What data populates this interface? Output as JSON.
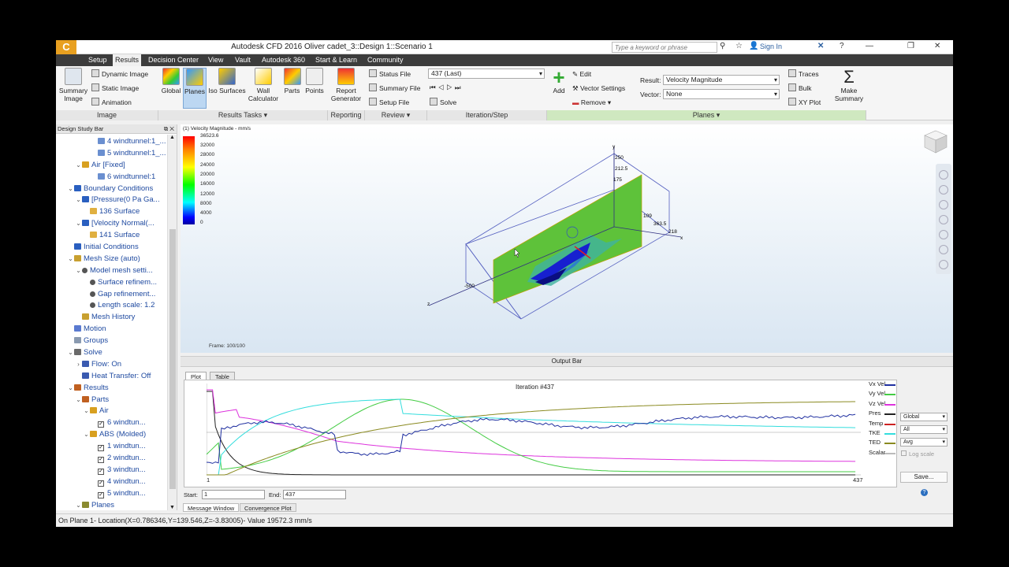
{
  "app": {
    "logo": "C",
    "title": "Autodesk CFD 2016   Oliver cadet_3::Design 1::Scenario 1",
    "search_placeholder": "Type a keyword or phrase",
    "signin": "Sign In"
  },
  "menus": [
    "Setup",
    "Results",
    "Decision Center",
    "View",
    "Vault",
    "Autodesk 360",
    "Start & Learn",
    "Community"
  ],
  "active_menu": "Results",
  "ribbon": {
    "image_group": {
      "summary_image": "Summary Image",
      "dynamic_image": "Dynamic Image",
      "static_image": "Static Image",
      "animation": "Animation",
      "title": "Image"
    },
    "results_tasks": {
      "items": [
        "Global",
        "Planes",
        "Iso Surfaces",
        "Wall Calculator",
        "Parts",
        "Points"
      ],
      "selected": "Planes",
      "title": "Results Tasks ▾"
    },
    "reporting": {
      "report_generator": "Report Generator",
      "title": "Reporting"
    },
    "review": {
      "status_file": "Status File",
      "summary_file": "Summary File",
      "setup_file": "Setup File",
      "title": "Review ▾"
    },
    "iteration": {
      "current": "437 (Last)",
      "solve": "Solve",
      "title": "Iteration/Step"
    },
    "planes": {
      "add": "Add",
      "edit": "Edit",
      "vector_settings": "Vector Settings",
      "remove": "Remove ▾",
      "result_label": "Result:",
      "result_value": "Velocity Magnitude",
      "vector_label": "Vector:",
      "vector_value": "None",
      "traces": "Traces",
      "bulk": "Bulk",
      "xy_plot": "XY Plot",
      "make_summary": "Make Summary",
      "title": "Planes ▾"
    }
  },
  "design_study_bar": {
    "title": "Design Study Bar",
    "items": [
      {
        "indent": 4,
        "arrow": "",
        "icon": "part",
        "label": "4 windtunnel:1_..."
      },
      {
        "indent": 4,
        "arrow": "",
        "icon": "part",
        "label": "5 windtunnel:1_..."
      },
      {
        "indent": 2,
        "arrow": "v",
        "icon": "material",
        "label": "Air [Fixed]"
      },
      {
        "indent": 4,
        "arrow": "",
        "icon": "part",
        "label": "6 windtunnel:1"
      },
      {
        "indent": 1,
        "arrow": "v",
        "icon": "bc",
        "label": "Boundary Conditions"
      },
      {
        "indent": 2,
        "arrow": "v",
        "icon": "bc",
        "label": "[Pressure(0 Pa Ga..."
      },
      {
        "indent": 3,
        "arrow": "",
        "icon": "surface",
        "label": "136 Surface"
      },
      {
        "indent": 2,
        "arrow": "v",
        "icon": "bc",
        "label": "[Velocity Normal(..."
      },
      {
        "indent": 3,
        "arrow": "",
        "icon": "surface",
        "label": "141 Surface"
      },
      {
        "indent": 1,
        "arrow": "",
        "icon": "bc",
        "label": "Initial Conditions"
      },
      {
        "indent": 1,
        "arrow": "v",
        "icon": "mesh",
        "label": "Mesh Size (auto)"
      },
      {
        "indent": 2,
        "arrow": "v",
        "icon": "info",
        "label": "Model mesh setti..."
      },
      {
        "indent": 3,
        "arrow": "",
        "icon": "info",
        "label": "Surface refinem..."
      },
      {
        "indent": 3,
        "arrow": "",
        "icon": "info",
        "label": "Gap refinement..."
      },
      {
        "indent": 3,
        "arrow": "",
        "icon": "info",
        "label": "Length scale: 1.2"
      },
      {
        "indent": 2,
        "arrow": "",
        "icon": "mesh",
        "label": "Mesh History"
      },
      {
        "indent": 1,
        "arrow": "",
        "icon": "motion",
        "label": "Motion"
      },
      {
        "indent": 1,
        "arrow": "",
        "icon": "groups",
        "label": "Groups"
      },
      {
        "indent": 1,
        "arrow": "v",
        "icon": "solve",
        "label": "Solve"
      },
      {
        "indent": 2,
        "arrow": ">",
        "icon": "flow",
        "label": "Flow: On"
      },
      {
        "indent": 2,
        "arrow": "",
        "icon": "flow",
        "label": "Heat Transfer: Off"
      },
      {
        "indent": 1,
        "arrow": "v",
        "icon": "results",
        "label": "Results"
      },
      {
        "indent": 2,
        "arrow": "v",
        "icon": "results",
        "label": "Parts"
      },
      {
        "indent": 3,
        "arrow": "v",
        "icon": "material",
        "label": "Air"
      },
      {
        "indent": 4,
        "arrow": "",
        "icon": "check",
        "label": "6 windtun..."
      },
      {
        "indent": 3,
        "arrow": "v",
        "icon": "material",
        "label": "ABS (Molded)"
      },
      {
        "indent": 4,
        "arrow": "",
        "icon": "check",
        "label": "1 windtun..."
      },
      {
        "indent": 4,
        "arrow": "",
        "icon": "check",
        "label": "2 windtun..."
      },
      {
        "indent": 4,
        "arrow": "",
        "icon": "check",
        "label": "3 windtun..."
      },
      {
        "indent": 4,
        "arrow": "",
        "icon": "check",
        "label": "4 windtun..."
      },
      {
        "indent": 4,
        "arrow": "",
        "icon": "check",
        "label": "5 windtun..."
      },
      {
        "indent": 2,
        "arrow": "v",
        "icon": "planes",
        "label": "Planes"
      }
    ]
  },
  "viewport": {
    "legend_title": "(1) Velocity Magnitude - mm/s",
    "legend_max": "36523.6",
    "legend_ticks": [
      "32000",
      "28000",
      "24000",
      "20000",
      "16000",
      "12000",
      "8000",
      "4000",
      "0"
    ],
    "frame": "Frame: 100/100",
    "axis_labels": [
      "y",
      "250",
      "212.5",
      "175",
      "109",
      "363.5",
      "218",
      "x",
      "z",
      "-500"
    ]
  },
  "output_bar": {
    "title": "Output Bar",
    "tabs": [
      "Plot",
      "Table"
    ],
    "iteration_label": "Iteration #437",
    "x_start": "1",
    "x_end": "437",
    "legend": [
      {
        "name": "Vx Vel",
        "color": "#1f2fa0"
      },
      {
        "name": "Vy Vel",
        "color": "#44cc44"
      },
      {
        "name": "Vz Vel",
        "color": "#dd33dd"
      },
      {
        "name": "Pres",
        "color": "#222222"
      },
      {
        "name": "Temp",
        "color": "#cc2222"
      },
      {
        "name": "TKE",
        "color": "#33dddd"
      },
      {
        "name": "TED",
        "color": "#8a8a20"
      },
      {
        "name": "Scalar",
        "color": "#bbbbbb"
      }
    ],
    "dropdowns": [
      "Global",
      "All",
      "Avg"
    ],
    "log_scale": "Log scale",
    "save": "Save...",
    "start_label": "Start:",
    "start_value": "1",
    "end_label": "End:",
    "end_value": "437",
    "bottom_tabs": [
      "Message Window",
      "Convergence Plot"
    ]
  },
  "status_bar": "On Plane 1- Location(X=0.786346,Y=139.546,Z=-3.83005)- Value  19572.3  mm/s"
}
